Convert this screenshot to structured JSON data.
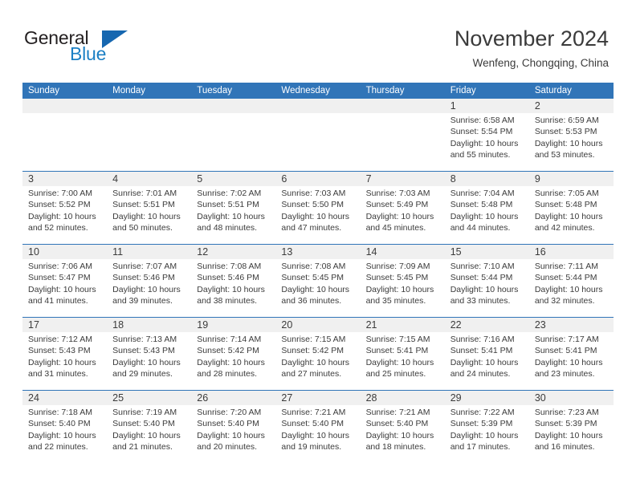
{
  "brand": {
    "name_top": "General",
    "name_bottom": "Blue",
    "accent_color": "#1b7fc4",
    "triangle_color": "#1667b0"
  },
  "header": {
    "title": "November 2024",
    "location": "Wenfeng, Chongqing, China"
  },
  "theme": {
    "header_blue": "#3175b8",
    "band_gray": "#f0f0f0",
    "text": "#3b3b3b"
  },
  "weekday_headers": [
    "Sunday",
    "Monday",
    "Tuesday",
    "Wednesday",
    "Thursday",
    "Friday",
    "Saturday"
  ],
  "weeks": [
    [
      {
        "day": "",
        "sunrise": "",
        "sunset": "",
        "daylight1": "",
        "daylight2": ""
      },
      {
        "day": "",
        "sunrise": "",
        "sunset": "",
        "daylight1": "",
        "daylight2": ""
      },
      {
        "day": "",
        "sunrise": "",
        "sunset": "",
        "daylight1": "",
        "daylight2": ""
      },
      {
        "day": "",
        "sunrise": "",
        "sunset": "",
        "daylight1": "",
        "daylight2": ""
      },
      {
        "day": "",
        "sunrise": "",
        "sunset": "",
        "daylight1": "",
        "daylight2": ""
      },
      {
        "day": "1",
        "sunrise": "Sunrise: 6:58 AM",
        "sunset": "Sunset: 5:54 PM",
        "daylight1": "Daylight: 10 hours",
        "daylight2": "and 55 minutes."
      },
      {
        "day": "2",
        "sunrise": "Sunrise: 6:59 AM",
        "sunset": "Sunset: 5:53 PM",
        "daylight1": "Daylight: 10 hours",
        "daylight2": "and 53 minutes."
      }
    ],
    [
      {
        "day": "3",
        "sunrise": "Sunrise: 7:00 AM",
        "sunset": "Sunset: 5:52 PM",
        "daylight1": "Daylight: 10 hours",
        "daylight2": "and 52 minutes."
      },
      {
        "day": "4",
        "sunrise": "Sunrise: 7:01 AM",
        "sunset": "Sunset: 5:51 PM",
        "daylight1": "Daylight: 10 hours",
        "daylight2": "and 50 minutes."
      },
      {
        "day": "5",
        "sunrise": "Sunrise: 7:02 AM",
        "sunset": "Sunset: 5:51 PM",
        "daylight1": "Daylight: 10 hours",
        "daylight2": "and 48 minutes."
      },
      {
        "day": "6",
        "sunrise": "Sunrise: 7:03 AM",
        "sunset": "Sunset: 5:50 PM",
        "daylight1": "Daylight: 10 hours",
        "daylight2": "and 47 minutes."
      },
      {
        "day": "7",
        "sunrise": "Sunrise: 7:03 AM",
        "sunset": "Sunset: 5:49 PM",
        "daylight1": "Daylight: 10 hours",
        "daylight2": "and 45 minutes."
      },
      {
        "day": "8",
        "sunrise": "Sunrise: 7:04 AM",
        "sunset": "Sunset: 5:48 PM",
        "daylight1": "Daylight: 10 hours",
        "daylight2": "and 44 minutes."
      },
      {
        "day": "9",
        "sunrise": "Sunrise: 7:05 AM",
        "sunset": "Sunset: 5:48 PM",
        "daylight1": "Daylight: 10 hours",
        "daylight2": "and 42 minutes."
      }
    ],
    [
      {
        "day": "10",
        "sunrise": "Sunrise: 7:06 AM",
        "sunset": "Sunset: 5:47 PM",
        "daylight1": "Daylight: 10 hours",
        "daylight2": "and 41 minutes."
      },
      {
        "day": "11",
        "sunrise": "Sunrise: 7:07 AM",
        "sunset": "Sunset: 5:46 PM",
        "daylight1": "Daylight: 10 hours",
        "daylight2": "and 39 minutes."
      },
      {
        "day": "12",
        "sunrise": "Sunrise: 7:08 AM",
        "sunset": "Sunset: 5:46 PM",
        "daylight1": "Daylight: 10 hours",
        "daylight2": "and 38 minutes."
      },
      {
        "day": "13",
        "sunrise": "Sunrise: 7:08 AM",
        "sunset": "Sunset: 5:45 PM",
        "daylight1": "Daylight: 10 hours",
        "daylight2": "and 36 minutes."
      },
      {
        "day": "14",
        "sunrise": "Sunrise: 7:09 AM",
        "sunset": "Sunset: 5:45 PM",
        "daylight1": "Daylight: 10 hours",
        "daylight2": "and 35 minutes."
      },
      {
        "day": "15",
        "sunrise": "Sunrise: 7:10 AM",
        "sunset": "Sunset: 5:44 PM",
        "daylight1": "Daylight: 10 hours",
        "daylight2": "and 33 minutes."
      },
      {
        "day": "16",
        "sunrise": "Sunrise: 7:11 AM",
        "sunset": "Sunset: 5:44 PM",
        "daylight1": "Daylight: 10 hours",
        "daylight2": "and 32 minutes."
      }
    ],
    [
      {
        "day": "17",
        "sunrise": "Sunrise: 7:12 AM",
        "sunset": "Sunset: 5:43 PM",
        "daylight1": "Daylight: 10 hours",
        "daylight2": "and 31 minutes."
      },
      {
        "day": "18",
        "sunrise": "Sunrise: 7:13 AM",
        "sunset": "Sunset: 5:43 PM",
        "daylight1": "Daylight: 10 hours",
        "daylight2": "and 29 minutes."
      },
      {
        "day": "19",
        "sunrise": "Sunrise: 7:14 AM",
        "sunset": "Sunset: 5:42 PM",
        "daylight1": "Daylight: 10 hours",
        "daylight2": "and 28 minutes."
      },
      {
        "day": "20",
        "sunrise": "Sunrise: 7:15 AM",
        "sunset": "Sunset: 5:42 PM",
        "daylight1": "Daylight: 10 hours",
        "daylight2": "and 27 minutes."
      },
      {
        "day": "21",
        "sunrise": "Sunrise: 7:15 AM",
        "sunset": "Sunset: 5:41 PM",
        "daylight1": "Daylight: 10 hours",
        "daylight2": "and 25 minutes."
      },
      {
        "day": "22",
        "sunrise": "Sunrise: 7:16 AM",
        "sunset": "Sunset: 5:41 PM",
        "daylight1": "Daylight: 10 hours",
        "daylight2": "and 24 minutes."
      },
      {
        "day": "23",
        "sunrise": "Sunrise: 7:17 AM",
        "sunset": "Sunset: 5:41 PM",
        "daylight1": "Daylight: 10 hours",
        "daylight2": "and 23 minutes."
      }
    ],
    [
      {
        "day": "24",
        "sunrise": "Sunrise: 7:18 AM",
        "sunset": "Sunset: 5:40 PM",
        "daylight1": "Daylight: 10 hours",
        "daylight2": "and 22 minutes."
      },
      {
        "day": "25",
        "sunrise": "Sunrise: 7:19 AM",
        "sunset": "Sunset: 5:40 PM",
        "daylight1": "Daylight: 10 hours",
        "daylight2": "and 21 minutes."
      },
      {
        "day": "26",
        "sunrise": "Sunrise: 7:20 AM",
        "sunset": "Sunset: 5:40 PM",
        "daylight1": "Daylight: 10 hours",
        "daylight2": "and 20 minutes."
      },
      {
        "day": "27",
        "sunrise": "Sunrise: 7:21 AM",
        "sunset": "Sunset: 5:40 PM",
        "daylight1": "Daylight: 10 hours",
        "daylight2": "and 19 minutes."
      },
      {
        "day": "28",
        "sunrise": "Sunrise: 7:21 AM",
        "sunset": "Sunset: 5:40 PM",
        "daylight1": "Daylight: 10 hours",
        "daylight2": "and 18 minutes."
      },
      {
        "day": "29",
        "sunrise": "Sunrise: 7:22 AM",
        "sunset": "Sunset: 5:39 PM",
        "daylight1": "Daylight: 10 hours",
        "daylight2": "and 17 minutes."
      },
      {
        "day": "30",
        "sunrise": "Sunrise: 7:23 AM",
        "sunset": "Sunset: 5:39 PM",
        "daylight1": "Daylight: 10 hours",
        "daylight2": "and 16 minutes."
      }
    ]
  ]
}
